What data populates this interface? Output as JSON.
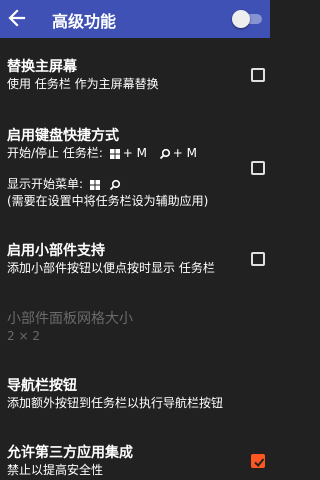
{
  "app_bar": {
    "title": "高级功能",
    "back_icon": "arrow-left-icon",
    "master_switch": false,
    "color": "#3f51b5"
  },
  "settings": {
    "replace_home": {
      "title": "替换主屏幕",
      "summary": "使用 任务栏 作为主屏幕替换",
      "checked": false
    },
    "keyboard_shortcut": {
      "title": "启用键盘快捷方式",
      "line1_prefix": "开始/停止 任务栏:",
      "line1_key1": "+ M",
      "line1_key2": "+ M",
      "line2_prefix": "显示开始菜单:",
      "line3": "(需要在设置中将任务栏设为辅助应用)",
      "checked": false
    },
    "widgets": {
      "title": "启用小部件支持",
      "summary": "添加小部件按钮以便点按时显示 任务栏",
      "checked": false
    },
    "widget_grid": {
      "title": "小部件面板网格大小",
      "summary": "2 × 2",
      "enabled": false
    },
    "nav_buttons": {
      "title": "导航栏按钮",
      "summary": "添加额外按钮到任务栏以执行导航栏按钮"
    },
    "third_party": {
      "title": "允许第三方应用集成",
      "summary": "禁止以提高安全性",
      "checked": true,
      "accent": "#ff5722"
    }
  }
}
